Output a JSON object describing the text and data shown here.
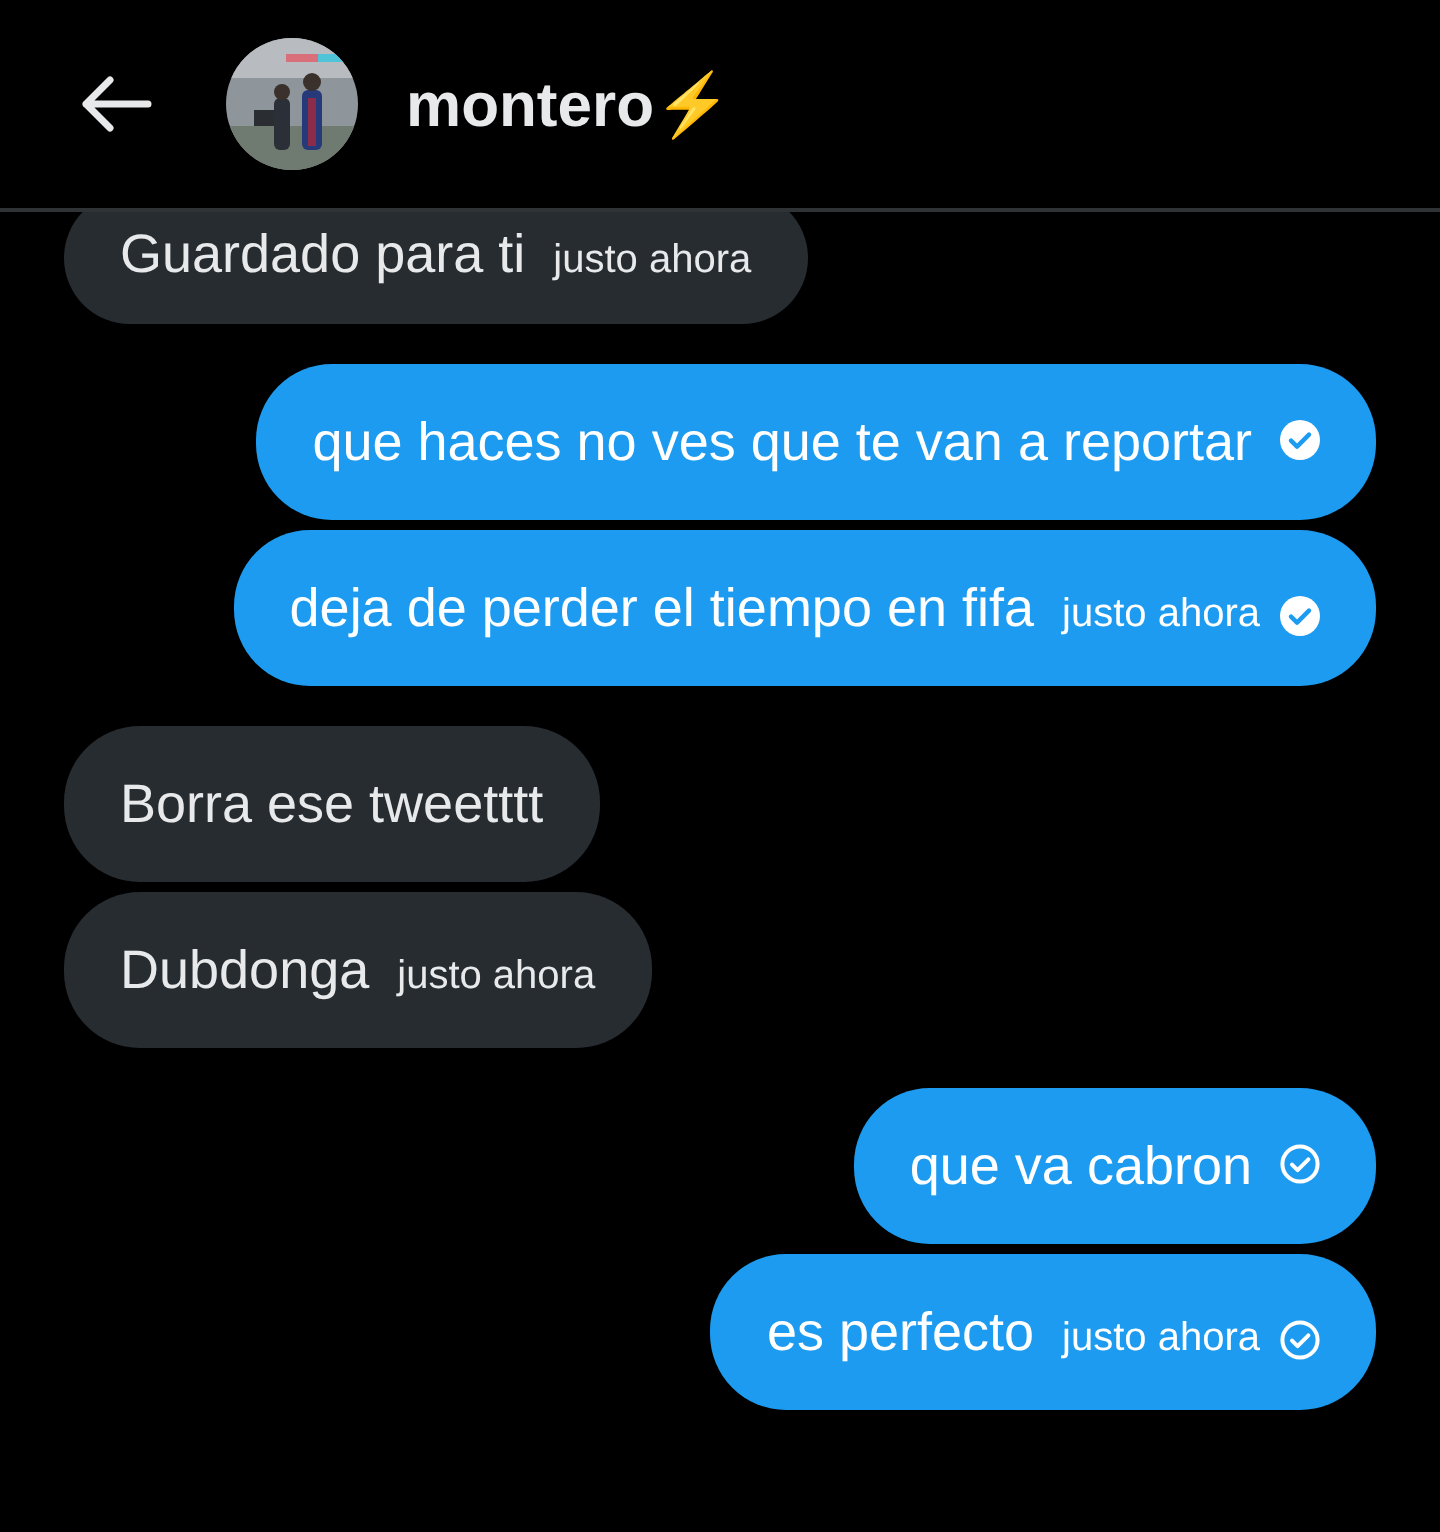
{
  "header": {
    "name": "montero⚡"
  },
  "messages": [
    {
      "kind": "received",
      "text": "Guardado para ti",
      "time": "justo ahora"
    },
    {
      "kind": "sent",
      "text": "que haces no ves que te van a reportar",
      "seen": true
    },
    {
      "kind": "sent",
      "text": "deja de perder el tiempo en fifa",
      "time": "justo ahora",
      "seen": true
    },
    {
      "kind": "received",
      "text": "Borra ese tweetttt"
    },
    {
      "kind": "received",
      "text": "Dubdonga",
      "time": "justo ahora"
    },
    {
      "kind": "sent",
      "text": "que va cabron",
      "seen": false
    },
    {
      "kind": "sent",
      "text": "es perfecto",
      "time": "justo ahora",
      "seen": false
    }
  ]
}
